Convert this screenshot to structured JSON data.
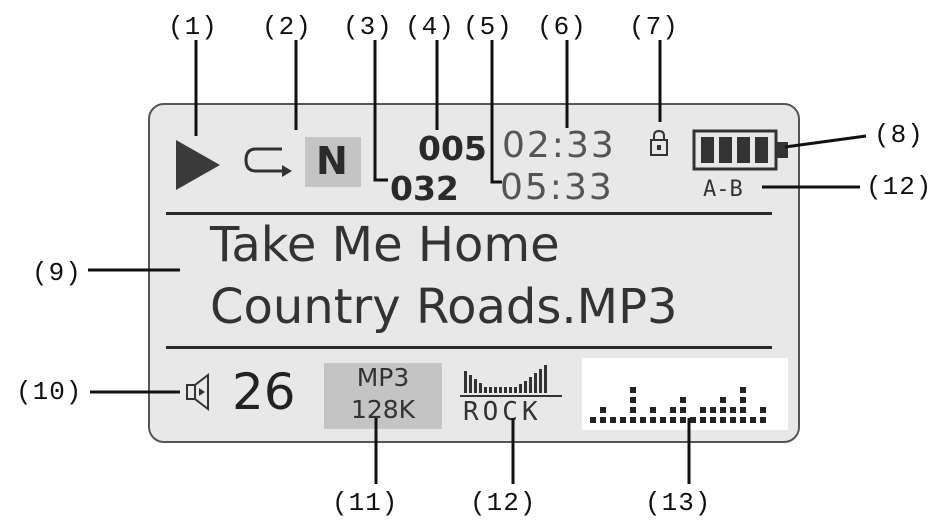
{
  "callouts": {
    "c1": "(1)",
    "c2": "(2)",
    "c3": "(3)",
    "c4": "(4)",
    "c5": "(5)",
    "c6": "(6)",
    "c7": "(7)",
    "c8": "(8)",
    "c9": "(9)",
    "c10": "(10)",
    "c11": "(11)",
    "c12a": "(12)",
    "c12b": "(12)",
    "c13": "(13)"
  },
  "display": {
    "mode_badge": "N",
    "track_number": "005",
    "total_tracks": "032",
    "elapsed_time": "02:33",
    "total_time": "05:33",
    "ab_repeat": "A-B",
    "title_line1": "Take Me Home",
    "title_line2": "Country Roads.MP3",
    "volume": "26",
    "format": "MP3",
    "bitrate": "128K",
    "eq_preset": "ROCK"
  },
  "icons": {
    "play": "play-icon",
    "repeat": "repeat-icon",
    "lock": "lock-icon",
    "battery": "battery-icon",
    "speaker": "speaker-icon",
    "eq_bars": "eq-bars-icon",
    "spectrum": "spectrum-analyzer"
  },
  "colors": {
    "screen_bg": "#e8e8e8",
    "ink": "#333333",
    "badge_bg": "#c4c4c4"
  }
}
